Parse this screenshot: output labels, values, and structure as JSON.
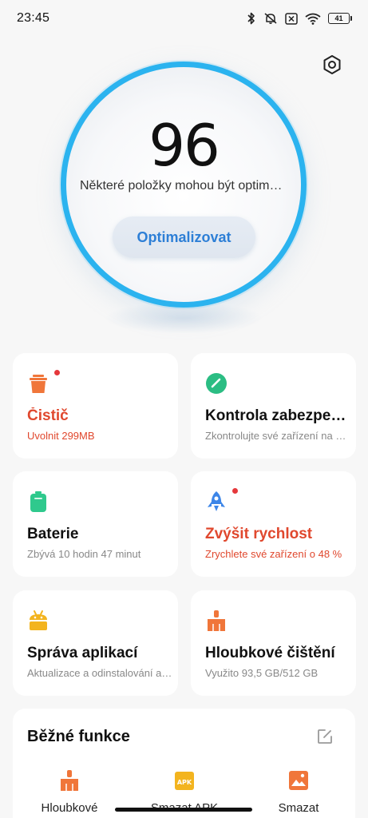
{
  "status_bar": {
    "time": "23:45",
    "battery": "41",
    "icons": [
      "bluetooth-icon",
      "silent-icon",
      "no-sim-icon",
      "wifi-icon",
      "battery-icon"
    ]
  },
  "hero": {
    "score": "96",
    "subtitle": "Některé položky mohou být optimalizovány",
    "button_label": "Optimalizovat",
    "ring_color": "#2bb3ef"
  },
  "cards": [
    {
      "icon": "trash-icon",
      "title": "Čistič",
      "subtitle": "Uvolnit 299MB",
      "alert": true,
      "badge": true,
      "icon_color": "#f0763a"
    },
    {
      "icon": "shield-gauge-icon",
      "title": "Kontrola zabezpečení",
      "subtitle": "Zkontrolujte své zařízení na hrozby",
      "alert": false,
      "badge": false,
      "icon_color": "#2bbd83"
    },
    {
      "icon": "battery-icon",
      "title": "Baterie",
      "subtitle": "Zbývá 10 hodin 47 minut",
      "alert": false,
      "badge": false,
      "icon_color": "#2fc98d"
    },
    {
      "icon": "rocket-icon",
      "title": "Zvýšit rychlost",
      "subtitle": "Zrychlete své zařízení o 48 %",
      "alert": true,
      "badge": true,
      "icon_color": "#3d86e8"
    },
    {
      "icon": "app-manager-icon",
      "title": "Správa aplikací",
      "subtitle": "Aktualizace a odinstalování aplikací",
      "alert": false,
      "badge": false,
      "icon_color": "#f3b41f"
    },
    {
      "icon": "broom-icon",
      "title": "Hloubkové čištění",
      "subtitle": "Využito 93,5 GB/512 GB",
      "alert": false,
      "badge": false,
      "icon_color": "#f0763a"
    }
  ],
  "common": {
    "title": "Běžné funkce",
    "items": [
      {
        "icon": "broom-icon",
        "label": "Hloubkové"
      },
      {
        "icon": "apk-icon",
        "label": "Smazat APK"
      },
      {
        "icon": "image-icon",
        "label": "Smazat"
      }
    ]
  }
}
